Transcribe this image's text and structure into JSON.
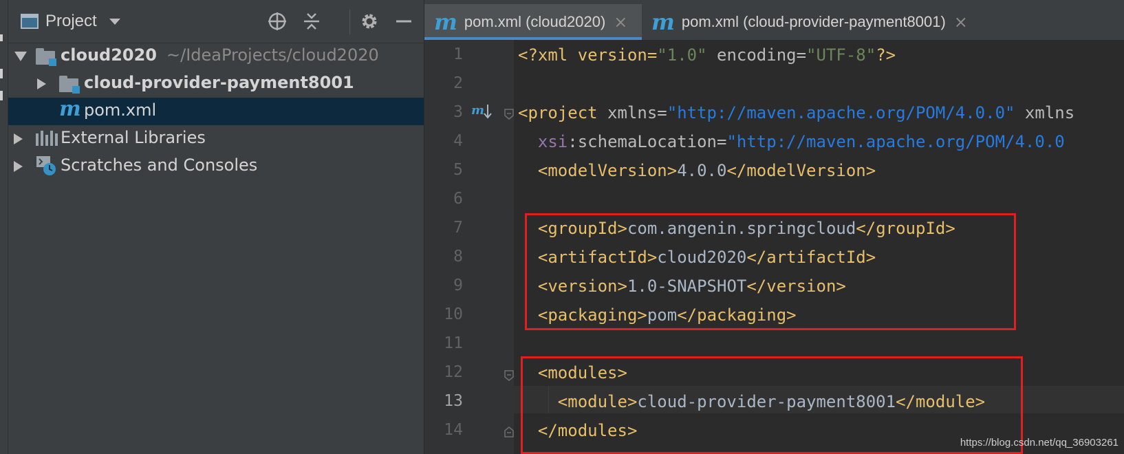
{
  "project_panel": {
    "title": "Project",
    "tree": [
      {
        "label": "cloud2020",
        "path": "~/IdeaProjects/cloud2020"
      },
      {
        "label": "cloud-provider-payment8001"
      },
      {
        "label": "pom.xml"
      },
      {
        "label": "External Libraries"
      },
      {
        "label": "Scratches and Consoles"
      }
    ]
  },
  "editor": {
    "tabs": [
      {
        "label": "pom.xml (cloud2020)",
        "close": "×"
      },
      {
        "label": "pom.xml (cloud-provider-payment8001)",
        "close": "×"
      }
    ],
    "tab_icon_letter": "m",
    "line_numbers": [
      "1",
      "2",
      "3",
      "4",
      "5",
      "6",
      "7",
      "8",
      "9",
      "10",
      "11",
      "12",
      "13",
      "14"
    ],
    "current_line": "13",
    "code": {
      "l1": [
        "<?xml version=",
        "\"1.0\"",
        " encoding=",
        "\"UTF-8\"",
        "?>"
      ],
      "l3": [
        "<project",
        " xmlns=",
        "\"http://maven.apache.org/POM/4.0.0\"",
        " xmlns"
      ],
      "l4": [
        "xsi",
        ":schemaLocation=",
        "\"http://maven.apache.org/POM/4.0.0"
      ],
      "l5": [
        "<modelVersion>",
        "4.0.0",
        "</modelVersion>"
      ],
      "l7": [
        "<groupId>",
        "com.angenin.springcloud",
        "</groupId>"
      ],
      "l8": [
        "<artifactId>",
        "cloud2020",
        "</artifactId>"
      ],
      "l9": [
        "<version>",
        "1.0-SNAPSHOT",
        "</version>"
      ],
      "l10": [
        "<packaging>",
        "pom",
        "</packaging>"
      ],
      "l12": [
        "<modules>"
      ],
      "l13": [
        "<module>",
        "cloud-provider-payment8001",
        "</module>"
      ],
      "l14": [
        "</modules>"
      ]
    }
  },
  "watermark": "https://blog.csdn.net/qq_36903261",
  "colors": {
    "accent": "#4a88c7",
    "highlight_box": "#e01f1f",
    "xml_tag": "#e8bf6a",
    "xml_string": "#6a8759",
    "maven_icon": "#3e9fd6"
  }
}
